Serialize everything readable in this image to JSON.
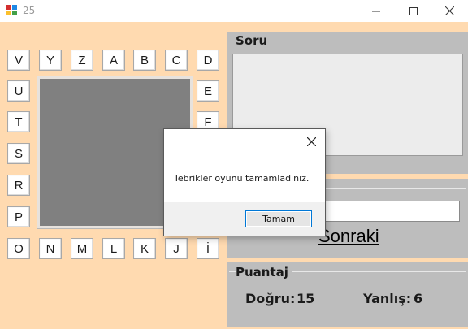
{
  "window": {
    "title": "25",
    "minimize_glyph": "—",
    "maximize_glyph": "☐",
    "close_glyph": "✕"
  },
  "letters": {
    "top": [
      "V",
      "Y",
      "Z",
      "A",
      "B",
      "C",
      "D"
    ],
    "left": [
      "U",
      "T",
      "S",
      "R",
      "P"
    ],
    "right": [
      "E",
      "F"
    ],
    "bottom": [
      "O",
      "N",
      "M",
      "L",
      "K",
      "J",
      "İ"
    ]
  },
  "soru": {
    "title": "Soru"
  },
  "answer": {
    "next_label": "Sonraki"
  },
  "puantaj": {
    "title": "Puantaj",
    "correct_label": "Doğru:",
    "correct_value": "15",
    "wrong_label": "Yanlış:",
    "wrong_value": "6"
  },
  "dialog": {
    "message": "Tebrikler oyunu tamamladınız.",
    "ok_label": "Tamam",
    "close_glyph": "✕"
  },
  "colors": {
    "background": "#ffdab0",
    "panel": "#bdbdbd",
    "board": "#808080",
    "accent": "#0078d7"
  }
}
